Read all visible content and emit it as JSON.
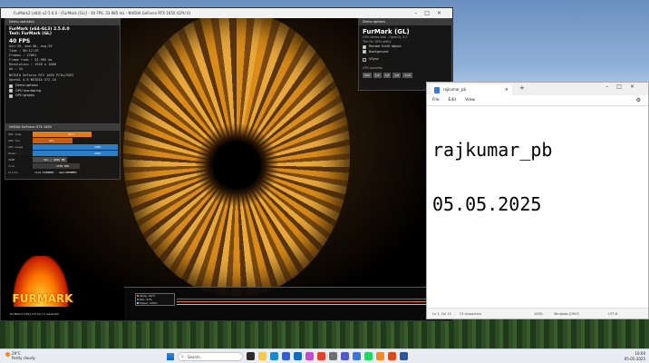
{
  "furmark": {
    "title": "FurMark2 (x64) v2.5.0.0 - [FurMark (GL)] - 40 FPS, 33.985 ms - NVIDIA GeForce RTX 1650 (GPU 0)",
    "stats_header": "Demo statistics",
    "stats_title": "FurMark (x64-GL3) 2.5.0.0",
    "test_line": "Test: FurMark (GL)",
    "fps": "40 FPS",
    "lines": [
      "min:39, max:48, avg:39",
      "Time      : 00:12:29",
      "Frames    : 27861",
      "Frame time : 33.985 ms",
      "Resolution : 1920 x 1080",
      "AA        : 2X"
    ],
    "api_lines": [
      "NVIDIA GeForce RTX 1650 PCIe/SSE2",
      "OpenGL 4.6 NVIDIA 572.16"
    ],
    "checkboxes": [
      "Demo options",
      "GPU monitoring",
      "GPU graphs"
    ],
    "gpu_header": "NVIDIA GeForce GTX 1650",
    "gpu_rows": [
      {
        "label": "GPU temp",
        "value": "69°C",
        "fill": 0.69,
        "color": "#e07b1a"
      },
      {
        "label": "GPU fan",
        "value": "47%",
        "fill": 0.47,
        "color": "#c2601a"
      },
      {
        "label": "GPU usage",
        "value": "100%",
        "fill": 1.0,
        "color": "#2a7fc8"
      },
      {
        "label": "Power",
        "value": "100%",
        "fill": 1.0,
        "color": "#2a7fc8"
      },
      {
        "label": "VRAM",
        "value": "341 / 4096 MB",
        "fill": 0.4,
        "color": "#4a4a4a"
      },
      {
        "label": "Core",
        "value": "1530 MHz",
        "fill": 0.55,
        "color": "#3a3a3a"
      },
      {
        "label": "Clocks",
        "value": "core:1590MHz - mem:6000MHz",
        "fill": 0.0,
        "color": "#333333"
      }
    ],
    "options_header": "Demo options",
    "options_name": "FurMark (GL)",
    "options_sub": "GPU stress test - OpenGL 3.2",
    "options_lines": [
      "The Fur GPU utility"
    ],
    "options_checks": [
      "Render fur/lit object",
      "Background"
    ],
    "vsync_label": "VSync",
    "resolutions_label": "GPU load/res",
    "resolutions": [
      "960",
      "1/2",
      "1/4",
      "1/8",
      "1/16"
    ],
    "logo_word": "FURMARK",
    "logo_version": "FurMark2 (x64) 2.5.0.0 (c) Geeks3D",
    "graph_legend": [
      {
        "label": "Temp: 69°C",
        "color": "#e07b1a"
      },
      {
        "label": "Fan: 47%",
        "color": "#2a7fc8"
      },
      {
        "label": "Power: 100%",
        "color": "#bbbbbb"
      }
    ]
  },
  "notepad": {
    "tab_title": "rajkumar_pb",
    "menu": [
      "File",
      "Edit",
      "View"
    ],
    "text_lines": [
      "rajkumar_pb",
      "05.05.2025"
    ],
    "status": {
      "position": "Ln 1, Col 12",
      "chars": "23 characters",
      "zoom": "100%",
      "eol": "Windows (CRLF)",
      "encoding": "UTF-8"
    }
  },
  "taskbar": {
    "weather_temp": "29°C",
    "weather_desc": "Partly cloudy",
    "search_placeholder": "Search",
    "time": "10:00",
    "date": "05-05-2025",
    "apps": [
      {
        "name": "task-view",
        "color": "#2b2b2b"
      },
      {
        "name": "file-explorer",
        "color": "#f2c94c"
      },
      {
        "name": "edge",
        "color": "#1e88c9"
      },
      {
        "name": "store",
        "color": "#2f5fd0"
      },
      {
        "name": "mail",
        "color": "#0f6cbd"
      },
      {
        "name": "photos",
        "color": "#c24bd0"
      },
      {
        "name": "chrome",
        "color": "#e3412f"
      },
      {
        "name": "settings",
        "color": "#707070"
      },
      {
        "name": "teams",
        "color": "#5059c9"
      },
      {
        "name": "notepad",
        "color": "#3a78d8"
      },
      {
        "name": "whatsapp",
        "color": "#25d366"
      },
      {
        "name": "vlc",
        "color": "#f08a2a"
      },
      {
        "name": "furmark",
        "color": "#d94a1a"
      },
      {
        "name": "word",
        "color": "#2b579a"
      }
    ]
  }
}
